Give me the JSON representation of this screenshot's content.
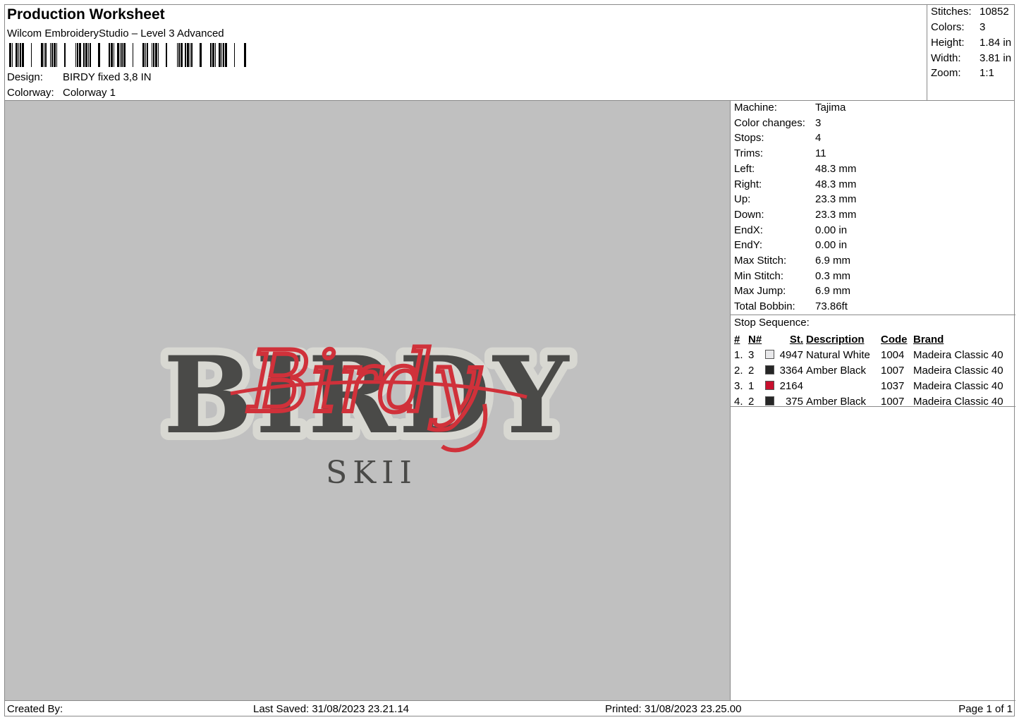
{
  "header": {
    "title": "Production Worksheet",
    "subtitle": "Wilcom EmbroideryStudio – Level 3 Advanced",
    "design_label": "Design:",
    "design_value": "BIRDY fixed 3,8 IN",
    "colorway_label": "Colorway:",
    "colorway_value": "Colorway 1"
  },
  "summary": {
    "stitches_label": "Stitches:",
    "stitches": "10852",
    "colors_label": "Colors:",
    "colors": "3",
    "height_label": "Height:",
    "height": "1.84 in",
    "width_label": "Width:",
    "width": "3.81 in",
    "zoom_label": "Zoom:",
    "zoom": "1:1"
  },
  "specs": [
    {
      "label": "Machine:",
      "value": "Tajima"
    },
    {
      "label": "Color changes:",
      "value": "3"
    },
    {
      "label": "Stops:",
      "value": "4"
    },
    {
      "label": "Trims:",
      "value": "11"
    },
    {
      "label": "Left:",
      "value": "48.3 mm"
    },
    {
      "label": "Right:",
      "value": "48.3 mm"
    },
    {
      "label": "Up:",
      "value": "23.3 mm"
    },
    {
      "label": "Down:",
      "value": "23.3 mm"
    },
    {
      "label": "EndX:",
      "value": "0.00 in"
    },
    {
      "label": "EndY:",
      "value": "0.00 in"
    },
    {
      "label": "Max Stitch:",
      "value": "6.9 mm"
    },
    {
      "label": "Min Stitch:",
      "value": "0.3 mm"
    },
    {
      "label": "Max Jump:",
      "value": "6.9 mm"
    },
    {
      "label": "Total Bobbin:",
      "value": "73.86ft"
    }
  ],
  "stops": {
    "caption": "Stop Sequence:",
    "headers": {
      "num": "#",
      "n": "N#",
      "st": "St.",
      "desc": "Description",
      "code": "Code",
      "brand": "Brand"
    },
    "rows": [
      {
        "num": "1.",
        "n": "3",
        "color": "#e8e8ea",
        "st": "4947",
        "desc": "Natural White",
        "code": "1004",
        "brand": "Madeira Classic 40"
      },
      {
        "num": "2.",
        "n": "2",
        "color": "#262626",
        "st": "3364",
        "desc": "Amber Black",
        "code": "1007",
        "brand": "Madeira Classic 40"
      },
      {
        "num": "3.",
        "n": "1",
        "color": "#c8102e",
        "st": "2164",
        "desc": "",
        "code": "1037",
        "brand": "Madeira Classic 40"
      },
      {
        "num": "4.",
        "n": "2",
        "color": "#262626",
        "st": "375",
        "desc": "Amber Black",
        "code": "1007",
        "brand": "Madeira Classic 40"
      }
    ]
  },
  "design_preview": {
    "main_text": "BIRDY",
    "script_text": "Birdy",
    "sub_text": "SKII",
    "colors": {
      "background": "#c0c0c0",
      "outline": "#d8d8d2",
      "letters": "#4a4a48",
      "script": "#d0313a"
    }
  },
  "footer": {
    "created_by": "Created By:",
    "last_saved": "Last Saved: 31/08/2023 23.21.14",
    "printed": "Printed: 31/08/2023 23.25.00",
    "page": "Page 1 of 1"
  }
}
